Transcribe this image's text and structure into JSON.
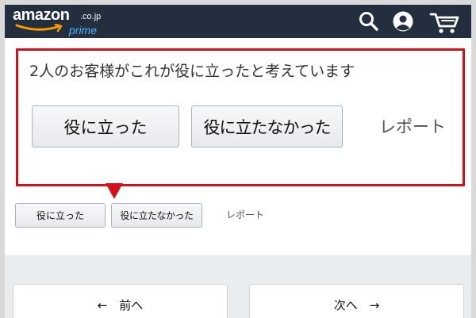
{
  "header": {
    "logo_text": "amazon",
    "logo_suffix": ".co.jp",
    "logo_sub": "prime",
    "icons": [
      "search-icon",
      "account-icon",
      "cart-icon"
    ],
    "colors": {
      "background": "#232f3e",
      "prime_blue": "#4eb6ff",
      "smile": "#ff9900"
    }
  },
  "zoom_callout": {
    "helpful_text": "2人のお客様がこれが役に立ったと考えています",
    "helpful_button": "役に立った",
    "not_helpful_button": "役に立たなかった",
    "report_link": "レポート",
    "highlight_color": "#d4111b"
  },
  "review_actions": {
    "helpful_button": "役に立った",
    "not_helpful_button": "役に立たなかった",
    "report_link": "レポート"
  },
  "pagination": {
    "prev_label": "←　前へ",
    "next_label": "次へ　→"
  }
}
